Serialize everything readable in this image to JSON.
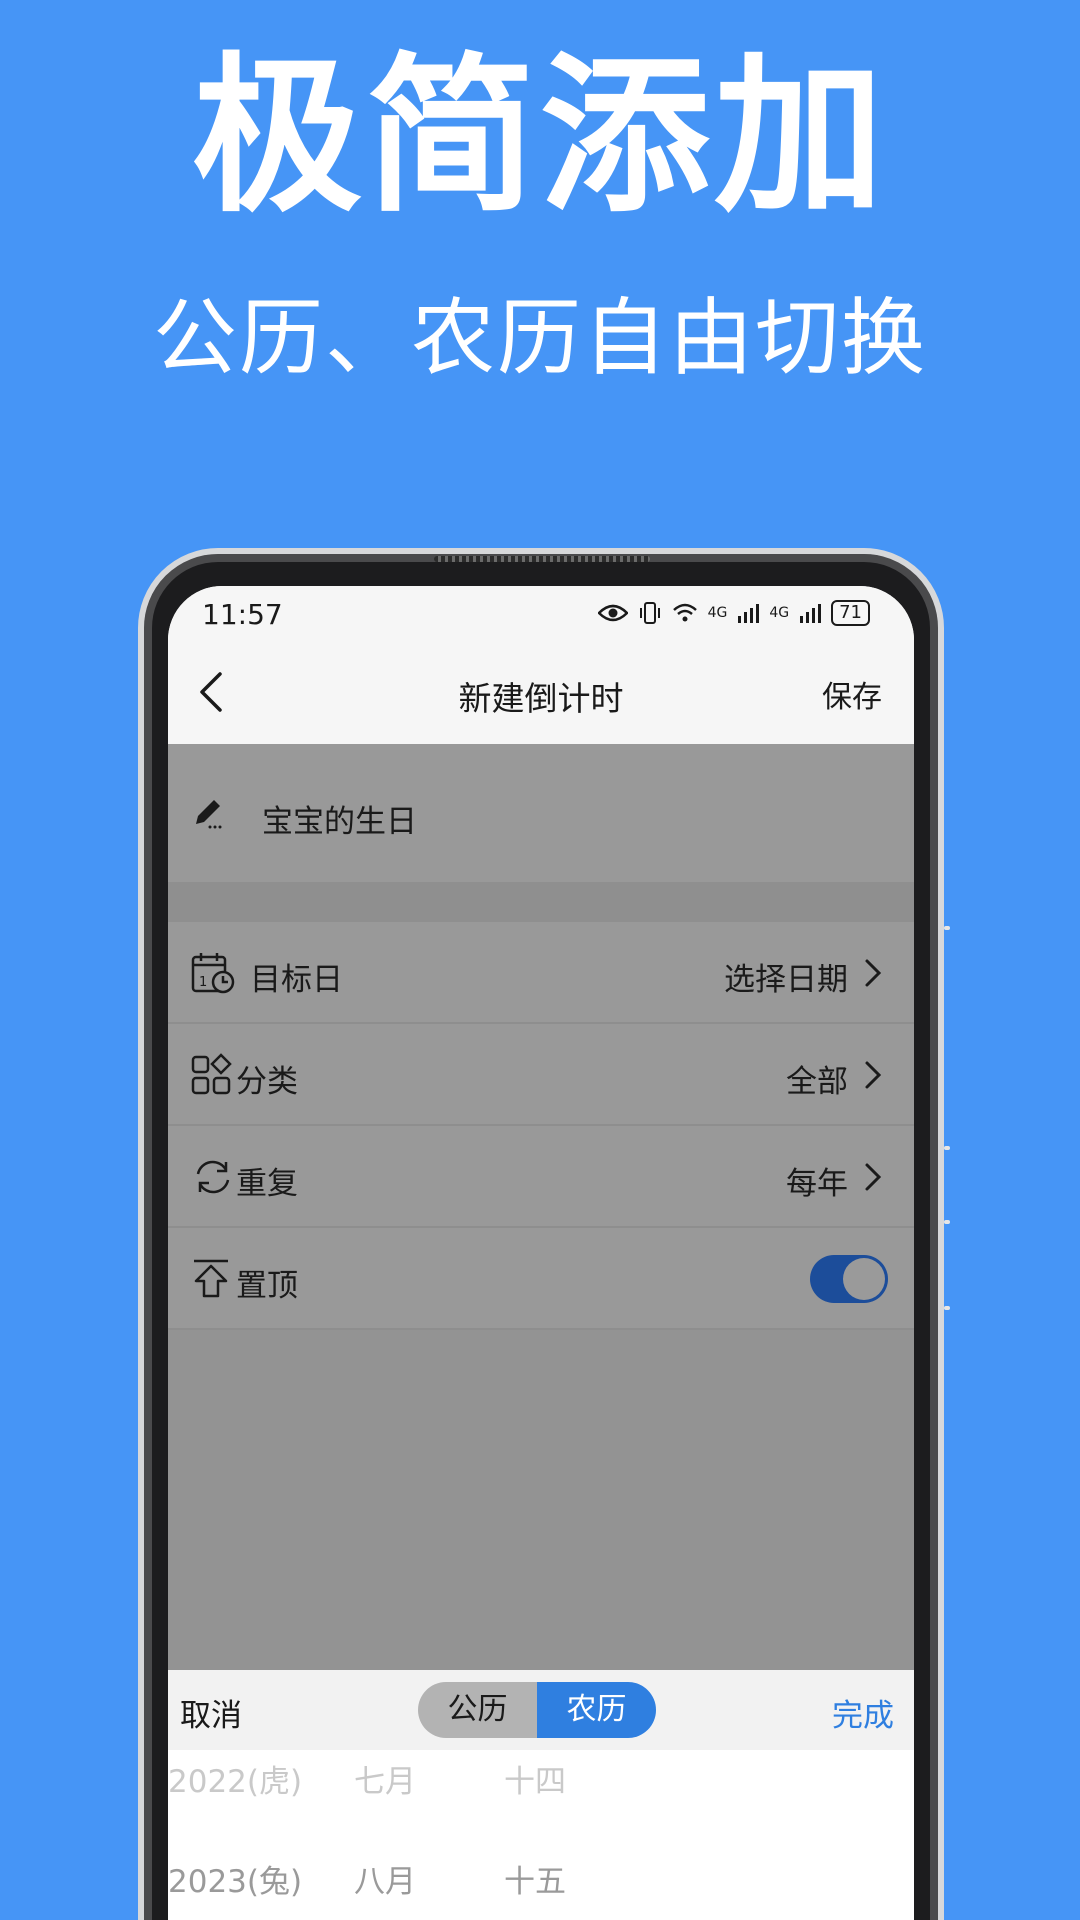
{
  "hero": {
    "title": "极简添加",
    "subtitle": "公历、农历自由切换"
  },
  "status_bar": {
    "time": "11:57",
    "network_1": "4G",
    "network_2": "4G",
    "battery": "71"
  },
  "nav": {
    "title": "新建倒计时",
    "save_label": "保存"
  },
  "name_field": {
    "value": "宝宝的生日"
  },
  "settings": {
    "target_date": {
      "label": "目标日",
      "value": "选择日期"
    },
    "category": {
      "label": "分类",
      "value": "全部"
    },
    "repeat": {
      "label": "重复",
      "value": "每年"
    },
    "pin_top": {
      "label": "置顶",
      "on": true
    }
  },
  "picker": {
    "cancel_label": "取消",
    "done_label": "完成",
    "segment": {
      "solar": "公历",
      "lunar": "农历",
      "selected": "lunar"
    },
    "rows": [
      {
        "year": "2022(虎)",
        "month": "七月",
        "day": "十四"
      },
      {
        "year": "2023(兔)",
        "month": "八月",
        "day": "十五"
      }
    ]
  },
  "colors": {
    "background": "#4695f6",
    "accent": "#2f7fe0",
    "toggle_on": "#1c4d9a"
  }
}
